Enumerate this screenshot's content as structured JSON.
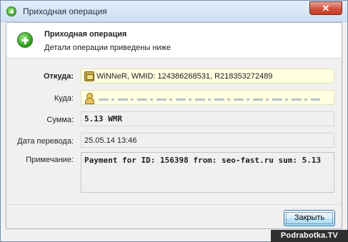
{
  "window": {
    "title": "Приходная операция",
    "close_label": "✕"
  },
  "header": {
    "title": "Приходная операция",
    "subtitle": "Детали операции приведены ниже"
  },
  "fields": {
    "from": {
      "label": "Откуда:",
      "value": "WiNNeR, WMID: 124386268531, R218353272489"
    },
    "to": {
      "label": "Куда:"
    },
    "amount": {
      "label": "Сумма:",
      "value": "5.13 WMR"
    },
    "date": {
      "label": "Дата перевода:",
      "value": "25.05.14 13:46"
    },
    "note": {
      "label": "Примечание:",
      "value": "Payment for ID: 156398 from: seo-fast.ru sum: 5.13"
    }
  },
  "buttons": {
    "close": "Закрыть"
  },
  "watermark": "Podrabotka.TV",
  "colors": {
    "accent_green": "#33a321",
    "highlight_field": "#ffffe1",
    "button_border": "#3c7fb1"
  },
  "icons": {
    "title": "plus-circle-icon",
    "header": "plus-circle-icon",
    "from": "wallet-icon",
    "to": "person-icon"
  }
}
